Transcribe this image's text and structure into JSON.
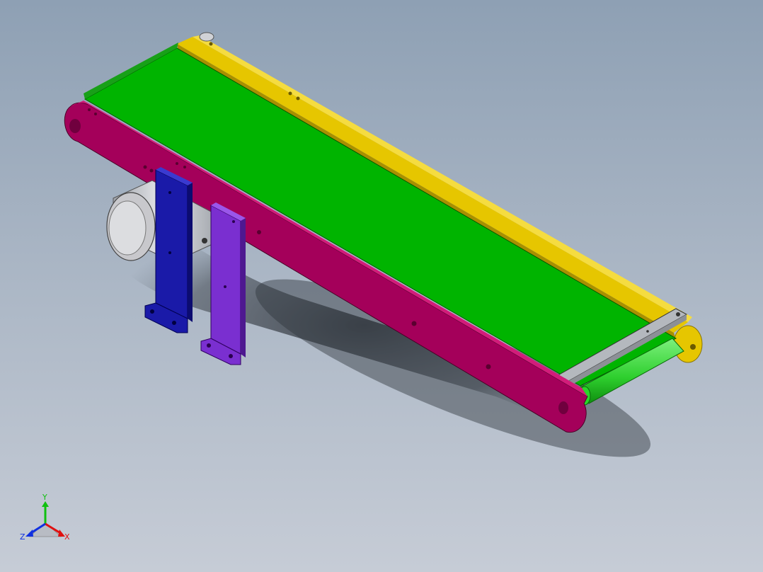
{
  "viewport": {
    "background_top": "#8ea0b4",
    "background_bottom": "#c6ccd6"
  },
  "model": {
    "parts": [
      {
        "name": "belt",
        "color": "#00b400"
      },
      {
        "name": "front-side-frame",
        "color": "#a4005a"
      },
      {
        "name": "rear-side-frame",
        "color": "#e6c600"
      },
      {
        "name": "end-roller",
        "color": "#29d629"
      },
      {
        "name": "end-cross-bar",
        "color": "#9ea2a8"
      },
      {
        "name": "support-leg-1",
        "color": "#1a1aa8"
      },
      {
        "name": "support-leg-2",
        "color": "#7a2fd0"
      },
      {
        "name": "drive-motor",
        "color": "#c8c8cc"
      }
    ]
  },
  "triad": {
    "x_label": "X",
    "y_label": "Y",
    "z_label": "Z",
    "x_color": "#e01010",
    "y_color": "#10c010",
    "z_color": "#1030e0"
  }
}
